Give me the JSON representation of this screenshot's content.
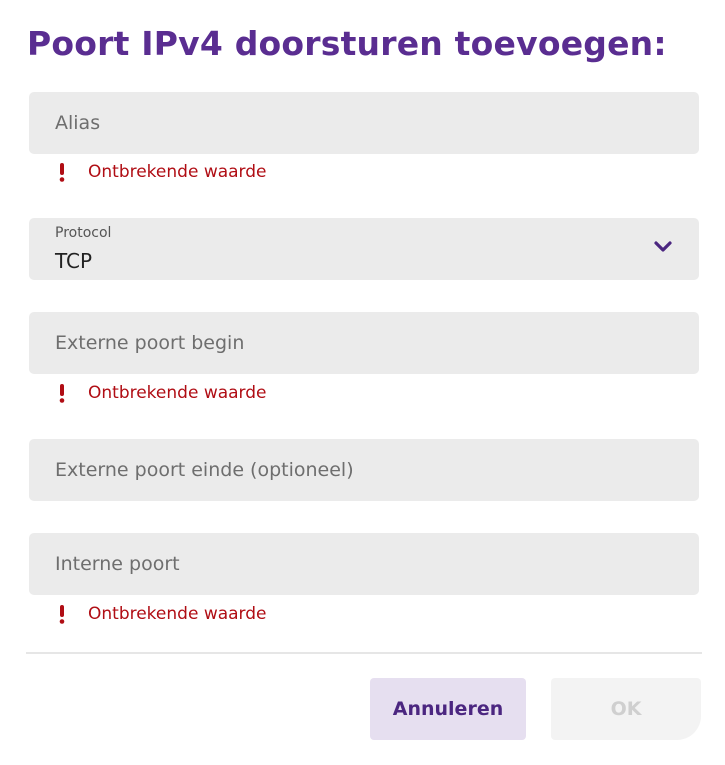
{
  "dialog": {
    "title": "Poort IPv4 doorsturen toevoegen:"
  },
  "fields": {
    "alias": {
      "placeholder": "Alias",
      "value": "",
      "error": "Ontbrekende waarde"
    },
    "protocol": {
      "label": "Protocol",
      "value": "TCP",
      "icon": "chevron-down-icon"
    },
    "external_port_start": {
      "placeholder": "Externe poort begin",
      "value": "",
      "error": "Ontbrekende waarde"
    },
    "external_port_end": {
      "placeholder": "Externe poort einde (optioneel)",
      "value": ""
    },
    "internal_port": {
      "placeholder": "Interne poort",
      "value": "",
      "error": "Ontbrekende waarde"
    }
  },
  "buttons": {
    "cancel_label": "Annuleren",
    "ok_label": "OK"
  },
  "colors": {
    "title": "#5a2d91",
    "field_background": "#ebebeb",
    "error": "#b00d14",
    "accent_purple": "#4b2680",
    "cancel_background": "#e6dff0",
    "ok_disabled_background": "#f3f3f3",
    "ok_disabled_text": "#cfcfcf"
  }
}
